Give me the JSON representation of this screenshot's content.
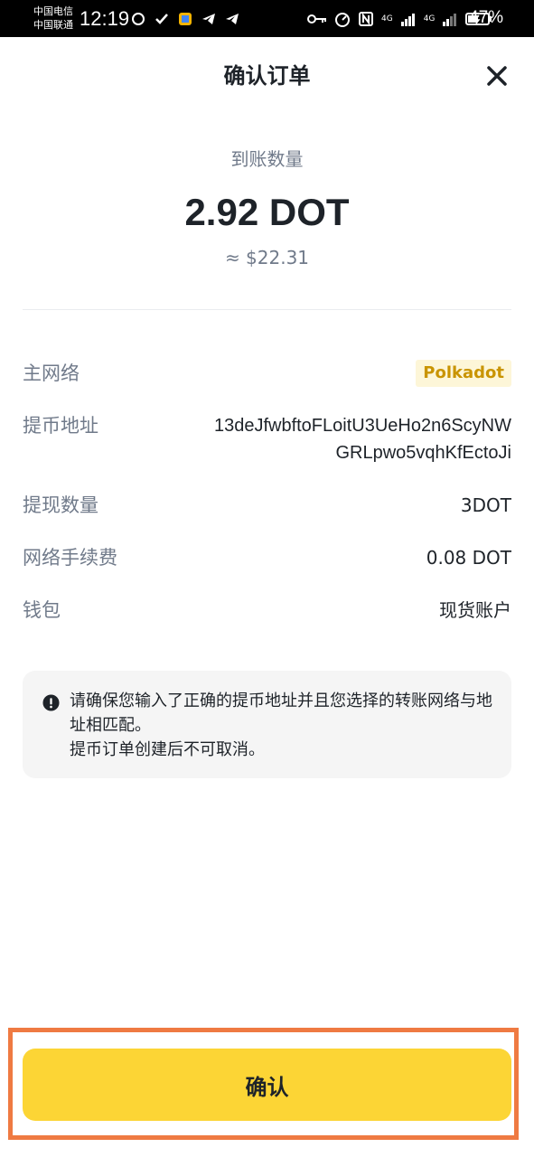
{
  "status_bar": {
    "carrier_1": "中国电信",
    "carrier_2": "中国联通",
    "time": "12:19",
    "network_1": "4G",
    "network_2": "4G",
    "battery_percent": "47%"
  },
  "header": {
    "title": "确认订单",
    "close_icon": "close-icon"
  },
  "amount": {
    "label": "到账数量",
    "value": "2.92 DOT",
    "fiat": "≈ $22.31"
  },
  "details": {
    "network_label": "主网络",
    "network_value": "Polkadot",
    "address_label": "提币地址",
    "address_value": "13deJfwbftoFLoitU3UeHo2n6ScyNWGRLpwo5vqhKfEctoJi",
    "withdraw_amount_label": "提现数量",
    "withdraw_amount_value": "3DOT",
    "fee_label": "网络手续费",
    "fee_value": "0.08 DOT",
    "wallet_label": "钱包",
    "wallet_value": "现货账户"
  },
  "warning": {
    "icon": "alert-circle-icon",
    "line_1": "请确保您输入了正确的提币地址并且您选择的转账网络与地址相匹配。",
    "line_2": "提币订单创建后不可取消。"
  },
  "confirm_button": {
    "label": "确认"
  },
  "colors": {
    "accent_yellow": "#fcd535",
    "tag_bg": "#fdf6d8",
    "tag_text": "#c99400",
    "highlight_frame": "#ef7a42"
  }
}
